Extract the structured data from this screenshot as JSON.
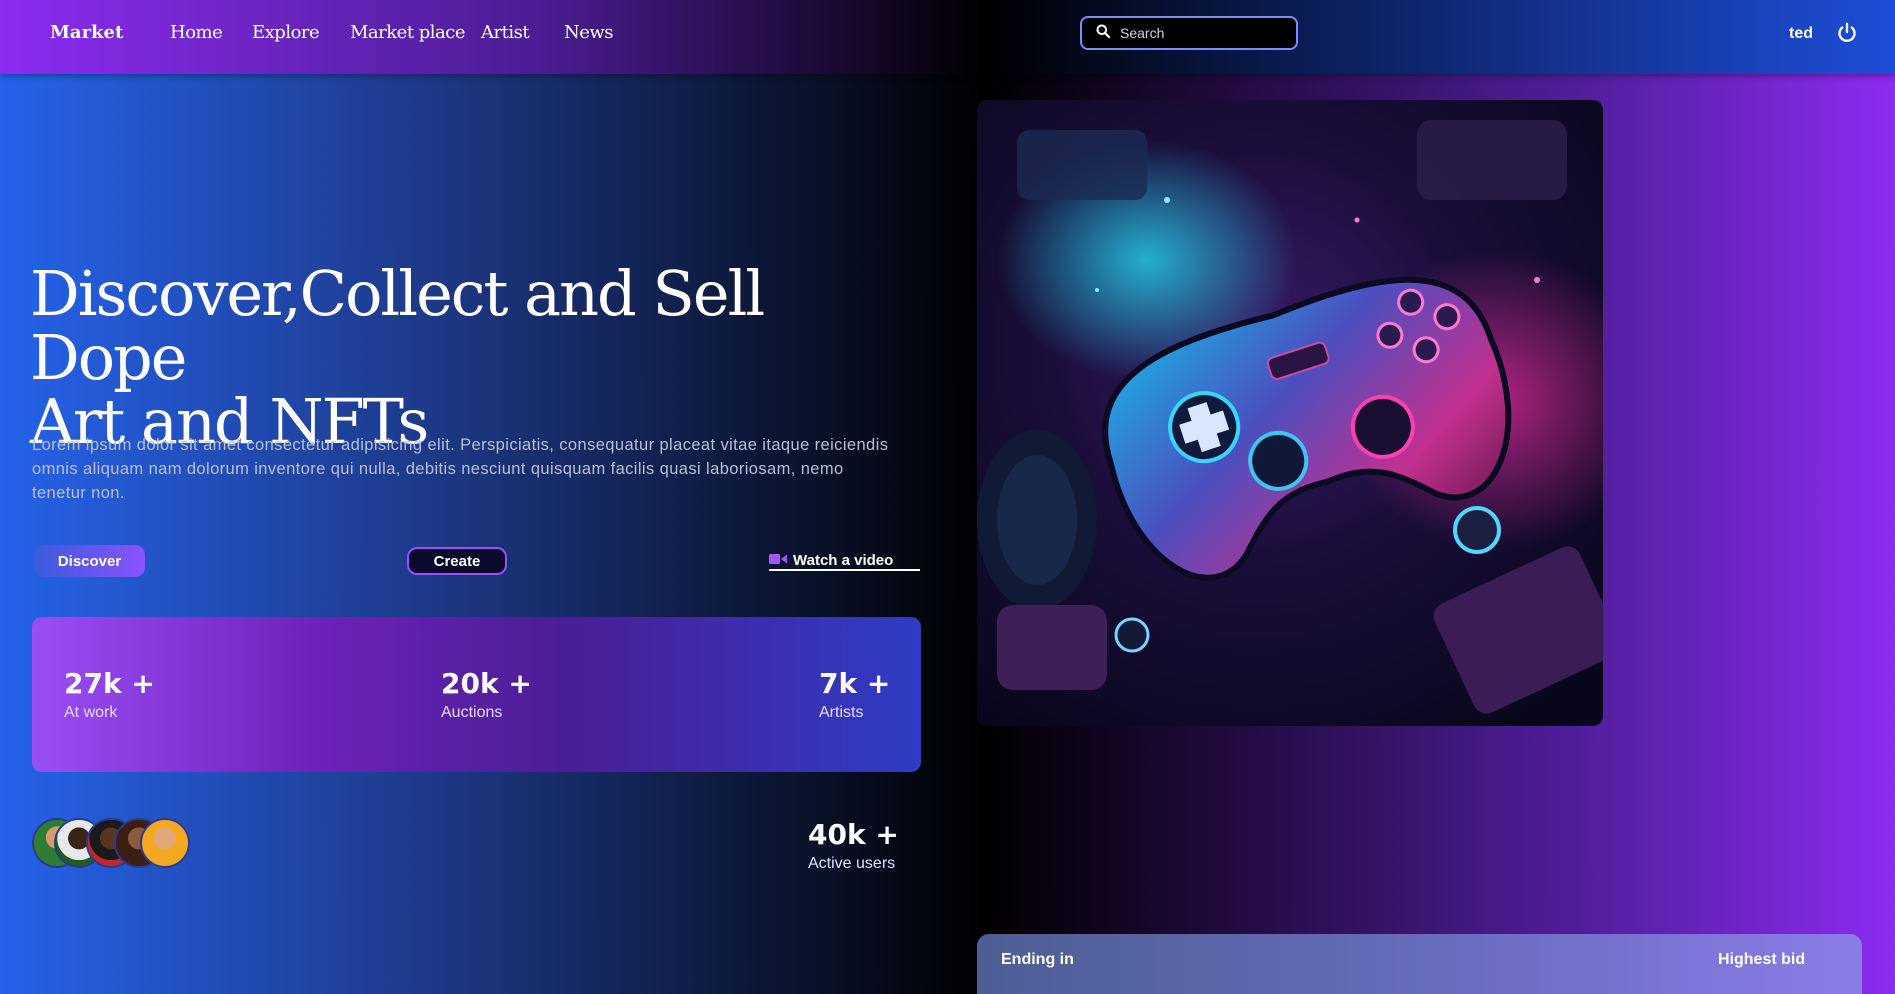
{
  "navbar": {
    "brand": "Market",
    "links": [
      "Home",
      "Explore",
      "Market place",
      "Artist",
      "News"
    ],
    "search_placeholder": "Search",
    "user_name": "ted"
  },
  "hero": {
    "title_line1": "Discover,Collect and Sell Dope",
    "title_line2": "Art and NFTs",
    "description": "Lorem ipsum dolor sit amet consectetur adipisicing elit. Perspiciatis, consequatur placeat vitae itaque reiciendis omnis aliquam nam dolorum inventore qui nulla, debitis nesciunt quisquam facilis quasi laboriosam, nemo tenetur non.",
    "discover_label": "Discover",
    "create_label": "Create",
    "watch_label": "Watch a video"
  },
  "stats": [
    {
      "value": "27k +",
      "label": "At work"
    },
    {
      "value": "20k +",
      "label": "Auctions"
    },
    {
      "value": "7k +",
      "label": "Artists"
    }
  ],
  "active_users": {
    "value": "40k +",
    "label": "Active users"
  },
  "auction_card": {
    "ending_label": "Ending in",
    "highest_bid_label": "Highest bid"
  },
  "colors": {
    "accent_purple": "#8b2cf0",
    "accent_blue": "#2563eb",
    "search_border": "#7c8cf8"
  }
}
